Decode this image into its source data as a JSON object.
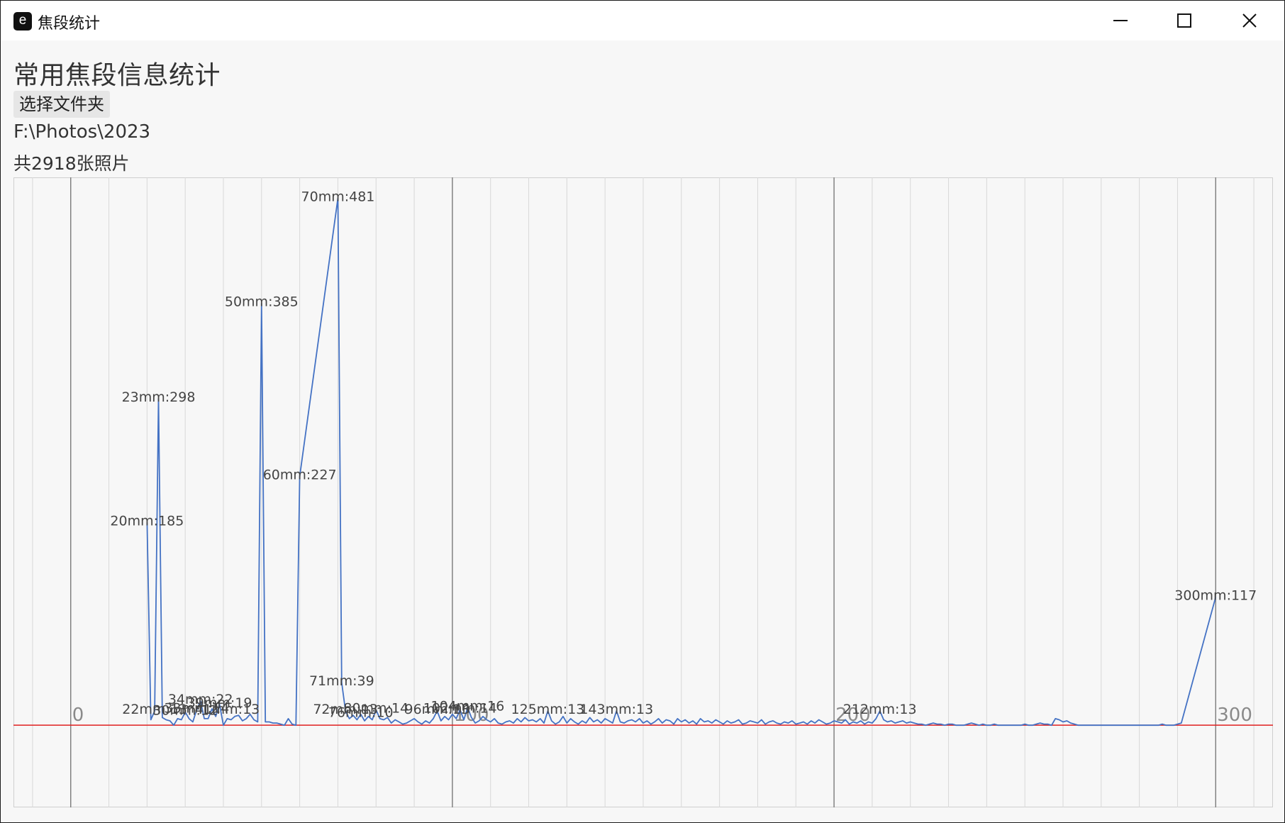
{
  "window": {
    "title": "焦段统计",
    "icon": "e",
    "minimize_icon": "minimize-icon",
    "maximize_icon": "maximize-icon",
    "close_icon": "close-icon"
  },
  "main": {
    "heading": "常用焦段信息统计",
    "select_folder_label": "选择文件夹",
    "folder_path": "F:\\Photos\\2023",
    "photo_count": "共2918张照片"
  },
  "colors": {
    "series": "#4472c4",
    "baseline": "#e02020",
    "grid_major": "#7a7a7a",
    "grid_minor": "#d8d8d8"
  },
  "chart_data": {
    "type": "line",
    "x_tick_labels": [
      "0",
      "100",
      "200",
      "300"
    ],
    "xlim": [
      -15,
      315
    ],
    "ylim": [
      -75,
      500
    ],
    "grid": true,
    "series": [
      {
        "points": [
          [
            20,
            185
          ],
          [
            21,
            5
          ],
          [
            22,
            13
          ],
          [
            23,
            298
          ],
          [
            24,
            7
          ],
          [
            25,
            5
          ],
          [
            26,
            4
          ],
          [
            27,
            0
          ],
          [
            28,
            6
          ],
          [
            29,
            5
          ],
          [
            30,
            12
          ],
          [
            31,
            6
          ],
          [
            32,
            3
          ],
          [
            33,
            14
          ],
          [
            34,
            22
          ],
          [
            35,
            6
          ],
          [
            36,
            6
          ],
          [
            37,
            15
          ],
          [
            38,
            8
          ],
          [
            39,
            19
          ],
          [
            40,
            0
          ],
          [
            41,
            6
          ],
          [
            42,
            5
          ],
          [
            43,
            8
          ],
          [
            44,
            9
          ],
          [
            45,
            4
          ],
          [
            46,
            6
          ],
          [
            47,
            10
          ],
          [
            48,
            5
          ],
          [
            49,
            3
          ],
          [
            50,
            385
          ],
          [
            51,
            3
          ],
          [
            52,
            3
          ],
          [
            53,
            2
          ],
          [
            54,
            2
          ],
          [
            55,
            1
          ],
          [
            56,
            0
          ],
          [
            57,
            6
          ],
          [
            58,
            1
          ],
          [
            59,
            0
          ],
          [
            60,
            227
          ],
          [
            70,
            481
          ],
          [
            71,
            39
          ],
          [
            72,
            13
          ],
          [
            73,
            6
          ],
          [
            74,
            9
          ],
          [
            75,
            5
          ],
          [
            76,
            10
          ],
          [
            77,
            4
          ],
          [
            78,
            8
          ],
          [
            79,
            5
          ],
          [
            80,
            14
          ],
          [
            81,
            6
          ],
          [
            82,
            5
          ],
          [
            83,
            7
          ],
          [
            84,
            2
          ],
          [
            85,
            5
          ],
          [
            86,
            3
          ],
          [
            87,
            1
          ],
          [
            88,
            2
          ],
          [
            89,
            4
          ],
          [
            90,
            6
          ],
          [
            91,
            3
          ],
          [
            92,
            1
          ],
          [
            93,
            4
          ],
          [
            94,
            2
          ],
          [
            95,
            6
          ],
          [
            96,
            13
          ],
          [
            97,
            4
          ],
          [
            98,
            8
          ],
          [
            99,
            5
          ],
          [
            100,
            10
          ],
          [
            101,
            6
          ],
          [
            102,
            14
          ],
          [
            103,
            5
          ],
          [
            104,
            16
          ],
          [
            105,
            7
          ],
          [
            106,
            2
          ],
          [
            107,
            4
          ],
          [
            108,
            8
          ],
          [
            109,
            5
          ],
          [
            110,
            3
          ],
          [
            111,
            6
          ],
          [
            112,
            2
          ],
          [
            113,
            1
          ],
          [
            114,
            3
          ],
          [
            115,
            4
          ],
          [
            116,
            2
          ],
          [
            117,
            6
          ],
          [
            118,
            3
          ],
          [
            119,
            7
          ],
          [
            120,
            4
          ],
          [
            121,
            5
          ],
          [
            122,
            3
          ],
          [
            123,
            6
          ],
          [
            124,
            2
          ],
          [
            125,
            13
          ],
          [
            126,
            4
          ],
          [
            127,
            1
          ],
          [
            128,
            3
          ],
          [
            129,
            8
          ],
          [
            130,
            2
          ],
          [
            131,
            6
          ],
          [
            132,
            3
          ],
          [
            133,
            1
          ],
          [
            134,
            4
          ],
          [
            135,
            2
          ],
          [
            136,
            7
          ],
          [
            137,
            3
          ],
          [
            138,
            5
          ],
          [
            139,
            2
          ],
          [
            140,
            6
          ],
          [
            141,
            4
          ],
          [
            142,
            2
          ],
          [
            143,
            13
          ],
          [
            144,
            3
          ],
          [
            145,
            2
          ],
          [
            146,
            4
          ],
          [
            147,
            5
          ],
          [
            148,
            3
          ],
          [
            149,
            6
          ],
          [
            150,
            2
          ],
          [
            151,
            4
          ],
          [
            152,
            1
          ],
          [
            153,
            3
          ],
          [
            154,
            6
          ],
          [
            155,
            2
          ],
          [
            156,
            5
          ],
          [
            157,
            4
          ],
          [
            158,
            1
          ],
          [
            159,
            6
          ],
          [
            160,
            3
          ],
          [
            161,
            5
          ],
          [
            162,
            2
          ],
          [
            163,
            4
          ],
          [
            164,
            1
          ],
          [
            165,
            6
          ],
          [
            166,
            3
          ],
          [
            167,
            4
          ],
          [
            168,
            2
          ],
          [
            169,
            5
          ],
          [
            170,
            3
          ],
          [
            171,
            1
          ],
          [
            172,
            4
          ],
          [
            173,
            2
          ],
          [
            174,
            3
          ],
          [
            175,
            5
          ],
          [
            176,
            1
          ],
          [
            177,
            2
          ],
          [
            178,
            4
          ],
          [
            179,
            3
          ],
          [
            180,
            2
          ],
          [
            181,
            5
          ],
          [
            182,
            1
          ],
          [
            183,
            3
          ],
          [
            184,
            4
          ],
          [
            185,
            2
          ],
          [
            186,
            1
          ],
          [
            187,
            3
          ],
          [
            188,
            2
          ],
          [
            189,
            4
          ],
          [
            190,
            1
          ],
          [
            191,
            2
          ],
          [
            192,
            3
          ],
          [
            193,
            1
          ],
          [
            194,
            4
          ],
          [
            195,
            2
          ],
          [
            196,
            5
          ],
          [
            197,
            3
          ],
          [
            198,
            1
          ],
          [
            199,
            2
          ],
          [
            200,
            4
          ],
          [
            201,
            3
          ],
          [
            202,
            2
          ],
          [
            203,
            5
          ],
          [
            204,
            1
          ],
          [
            205,
            3
          ],
          [
            206,
            2
          ],
          [
            207,
            4
          ],
          [
            208,
            1
          ],
          [
            209,
            3
          ],
          [
            210,
            2
          ],
          [
            211,
            6
          ],
          [
            212,
            13
          ],
          [
            213,
            5
          ],
          [
            214,
            3
          ],
          [
            215,
            4
          ],
          [
            216,
            2
          ],
          [
            217,
            3
          ],
          [
            218,
            4
          ],
          [
            219,
            2
          ],
          [
            220,
            3
          ],
          [
            221,
            2
          ],
          [
            222,
            1
          ],
          [
            223,
            1
          ],
          [
            224,
            0
          ],
          [
            225,
            1
          ],
          [
            226,
            2
          ],
          [
            227,
            1
          ],
          [
            228,
            1
          ],
          [
            229,
            0
          ],
          [
            230,
            1
          ],
          [
            231,
            1
          ],
          [
            232,
            0
          ],
          [
            233,
            0
          ],
          [
            234,
            0
          ],
          [
            235,
            1
          ],
          [
            236,
            2
          ],
          [
            237,
            1
          ],
          [
            238,
            0
          ],
          [
            239,
            1
          ],
          [
            240,
            0
          ],
          [
            241,
            0
          ],
          [
            242,
            1
          ],
          [
            243,
            0
          ],
          [
            244,
            0
          ],
          [
            245,
            0
          ],
          [
            246,
            0
          ],
          [
            247,
            0
          ],
          [
            248,
            0
          ],
          [
            249,
            0
          ],
          [
            250,
            1
          ],
          [
            251,
            0
          ],
          [
            252,
            0
          ],
          [
            253,
            1
          ],
          [
            254,
            2
          ],
          [
            255,
            1
          ],
          [
            256,
            1
          ],
          [
            257,
            0
          ],
          [
            258,
            6
          ],
          [
            259,
            5
          ],
          [
            260,
            3
          ],
          [
            261,
            4
          ],
          [
            262,
            2
          ],
          [
            263,
            1
          ],
          [
            264,
            0
          ],
          [
            265,
            0
          ],
          [
            266,
            0
          ],
          [
            267,
            0
          ],
          [
            268,
            0
          ],
          [
            269,
            0
          ],
          [
            270,
            0
          ],
          [
            271,
            0
          ],
          [
            272,
            0
          ],
          [
            273,
            0
          ],
          [
            274,
            0
          ],
          [
            275,
            0
          ],
          [
            276,
            0
          ],
          [
            277,
            0
          ],
          [
            278,
            0
          ],
          [
            279,
            0
          ],
          [
            280,
            0
          ],
          [
            281,
            0
          ],
          [
            282,
            0
          ],
          [
            283,
            0
          ],
          [
            284,
            0
          ],
          [
            285,
            0
          ],
          [
            286,
            1
          ],
          [
            287,
            0
          ],
          [
            288,
            0
          ],
          [
            289,
            0
          ],
          [
            290,
            1
          ],
          [
            291,
            2
          ],
          [
            300,
            117
          ]
        ],
        "point_labels": [
          {
            "text": "20mm:185",
            "x": 20,
            "y": 185
          },
          {
            "text": "23mm:298",
            "x": 23,
            "y": 298
          },
          {
            "text": "22mm:13",
            "x": 22,
            "y": 13
          },
          {
            "text": "30mm:12",
            "x": 30,
            "y": 12
          },
          {
            "text": "33mm:14",
            "x": 33,
            "y": 14
          },
          {
            "text": "34mm:22",
            "x": 34,
            "y": 22
          },
          {
            "text": "39mm:19",
            "x": 39,
            "y": 19
          },
          {
            "text": "41mm:13",
            "x": 41,
            "y": 13
          },
          {
            "text": "50mm:385",
            "x": 50,
            "y": 385
          },
          {
            "text": "60mm:227",
            "x": 60,
            "y": 227
          },
          {
            "text": "70mm:481",
            "x": 70,
            "y": 481
          },
          {
            "text": "71mm:39",
            "x": 71,
            "y": 39
          },
          {
            "text": "72mm:13",
            "x": 72,
            "y": 13
          },
          {
            "text": "76mm:10",
            "x": 76,
            "y": 10
          },
          {
            "text": "80mm:14",
            "x": 80,
            "y": 14
          },
          {
            "text": "96mm:13",
            "x": 96,
            "y": 13
          },
          {
            "text": "102mm:14",
            "x": 102,
            "y": 14
          },
          {
            "text": "104mm:16",
            "x": 104,
            "y": 16
          },
          {
            "text": "125mm:13",
            "x": 125,
            "y": 13
          },
          {
            "text": "143mm:13",
            "x": 143,
            "y": 13
          },
          {
            "text": "212mm:13",
            "x": 212,
            "y": 13
          },
          {
            "text": "300mm:117",
            "x": 300,
            "y": 117
          }
        ]
      }
    ]
  }
}
